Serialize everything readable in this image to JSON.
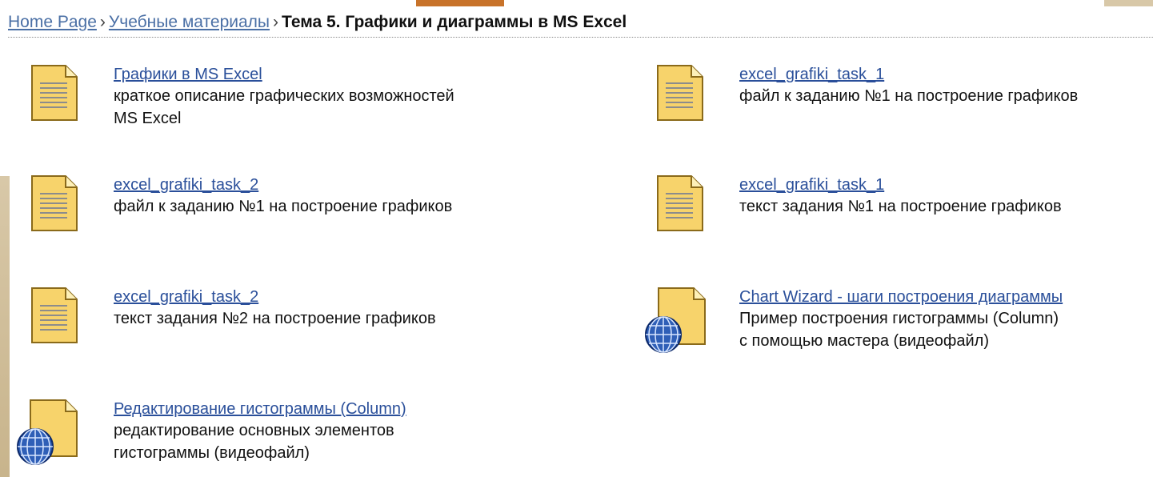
{
  "breadcrumb": {
    "home": "Home Page",
    "separator1": "›",
    "section": "Учебные материалы",
    "separator2": "›",
    "current": "Тема 5. Графики и диаграммы в MS Excel"
  },
  "items": [
    {
      "icon": "document-icon",
      "title": "Графики в MS Excel",
      "desc1": "краткое описание графических возможностей",
      "desc2": "MS Excel"
    },
    {
      "icon": "document-icon",
      "title": "excel_grafiki_task_1",
      "desc1": "файл к заданию №1 на построение графиков",
      "desc2": ""
    },
    {
      "icon": "document-icon",
      "title": "excel_grafiki_task_2",
      "desc1": "файл к заданию №1 на построение графиков",
      "desc2": ""
    },
    {
      "icon": "document-icon",
      "title": "excel_grafiki_task_1",
      "desc1": "текст задания №1 на построение графиков",
      "desc2": ""
    },
    {
      "icon": "document-icon",
      "title": "excel_grafiki_task_2",
      "desc1": "текст задания №2 на построение графиков",
      "desc2": ""
    },
    {
      "icon": "web-document-icon",
      "title": "Chart Wizard - шаги построения диаграммы",
      "desc1": "Пример построения гистограммы (Column)",
      "desc2": "с помощью мастера (видеофайл)"
    },
    {
      "icon": "web-document-icon",
      "title": "Редактирование гистограммы (Column)",
      "desc1": "редактирование основных элементов",
      "desc2": "гистограммы (видеофайл)"
    }
  ],
  "colors": {
    "link": "#2a4f9a",
    "icon_fill": "#f7d36b",
    "icon_border": "#8a6a1a",
    "globe": "#2f5fb7"
  }
}
